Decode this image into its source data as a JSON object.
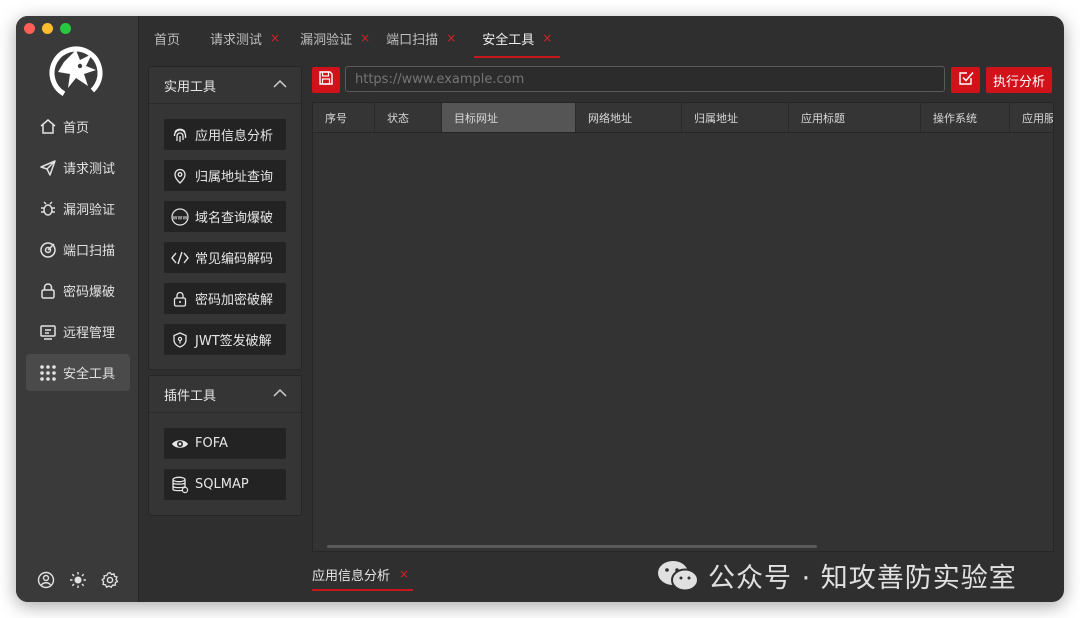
{
  "window": {
    "traffic_lights": [
      "#ff5f57",
      "#febc2e",
      "#28c840"
    ]
  },
  "sidebar": {
    "logo": "dragon-logo",
    "items": [
      {
        "label": "首页",
        "icon": "home-icon"
      },
      {
        "label": "请求测试",
        "icon": "send-icon"
      },
      {
        "label": "漏洞验证",
        "icon": "bug-icon"
      },
      {
        "label": "端口扫描",
        "icon": "radar-icon"
      },
      {
        "label": "密码爆破",
        "icon": "lock-icon"
      },
      {
        "label": "远程管理",
        "icon": "terminal-icon"
      },
      {
        "label": "安全工具",
        "icon": "grid-dots-icon",
        "active": true
      }
    ],
    "bottom_icons": [
      "user-icon",
      "sun-icon",
      "gear-icon"
    ]
  },
  "tabs": [
    {
      "label": "首页",
      "closable": false
    },
    {
      "label": "请求测试",
      "closable": true
    },
    {
      "label": "漏洞验证",
      "closable": true
    },
    {
      "label": "端口扫描",
      "closable": true
    },
    {
      "label": "安全工具",
      "closable": true,
      "active": true
    }
  ],
  "tab_close_glyph": "×",
  "practical_tools": {
    "title": "实用工具",
    "items": [
      {
        "label": "应用信息分析",
        "icon": "fingerprint-icon"
      },
      {
        "label": "归属地址查询",
        "icon": "location-pin-icon"
      },
      {
        "label": "域名查询爆破",
        "icon": "www-icon"
      },
      {
        "label": "常见编码解码",
        "icon": "code-icon"
      },
      {
        "label": "密码加密破解",
        "icon": "lock-icon"
      },
      {
        "label": "JWT签发破解",
        "icon": "shield-key-icon"
      }
    ]
  },
  "plugin_tools": {
    "title": "插件工具",
    "items": [
      {
        "label": "FOFA",
        "icon": "eye-icon"
      },
      {
        "label": "SQLMAP",
        "icon": "database-icon"
      }
    ]
  },
  "toolbar": {
    "save_icon": "save-icon",
    "url_placeholder": "https://www.example.com",
    "check_icon": "checkbox-icon",
    "run_label": "执行分析"
  },
  "table": {
    "columns": [
      "序号",
      "状态",
      "目标网址",
      "网络地址",
      "归属地址",
      "应用标题",
      "操作系统",
      "应用服"
    ],
    "highlighted_column": "目标网址",
    "rows": []
  },
  "bottom_tab": {
    "label": "应用信息分析"
  },
  "watermark": {
    "text": "公众号 · 知攻善防实验室",
    "icon": "wechat-icon"
  },
  "colors": {
    "accent": "#d1121a",
    "background": "#2f2f2f",
    "sidebar": "#3a3a3a",
    "button": "#232323"
  }
}
